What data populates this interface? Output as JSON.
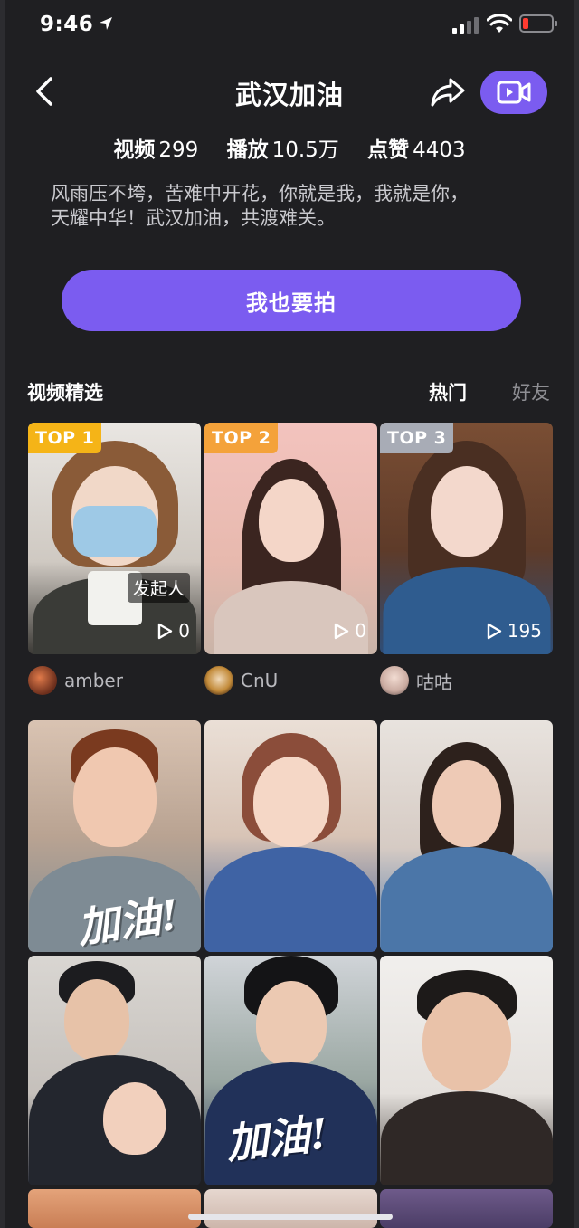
{
  "status_bar": {
    "time": "9:46",
    "colors": {
      "battery_low": "#ff3b30"
    }
  },
  "header": {
    "title": "武汉加油",
    "icons": {
      "back": "chevron-left-icon",
      "share": "share-arrow-icon",
      "record": "video-camera-icon"
    }
  },
  "stats": [
    {
      "label": "视频",
      "value": "299"
    },
    {
      "label": "播放",
      "value": "10.5万"
    },
    {
      "label": "点赞",
      "value": "4403"
    }
  ],
  "description": {
    "line1": "风雨压不垮，苦难中开花，你就是我，我就是你，",
    "line2": "天耀中华！武汉加油，共渡难关。"
  },
  "shoot_button": {
    "label": "我也要拍"
  },
  "section": {
    "title": "视频精选",
    "tabs": [
      {
        "label": "热门",
        "active": true
      },
      {
        "label": "好友",
        "active": false
      }
    ]
  },
  "top_videos": [
    {
      "rank": "TOP 1",
      "plays": "0",
      "author": "amber",
      "tag": "发起人"
    },
    {
      "rank": "TOP 2",
      "plays": "0",
      "author": "CnU"
    },
    {
      "rank": "TOP 3",
      "plays": "195",
      "author": "咕咕"
    }
  ],
  "grid_overlays": {
    "tile_a": "加油!",
    "tile_b": "加油!"
  },
  "colors": {
    "accent": "#7b5cf0",
    "background": "#1f1f22",
    "rank1": "#f5b417",
    "rank2": "#f4a23a",
    "rank3": "#a8acb6",
    "muted_text": "#8e8e93"
  }
}
